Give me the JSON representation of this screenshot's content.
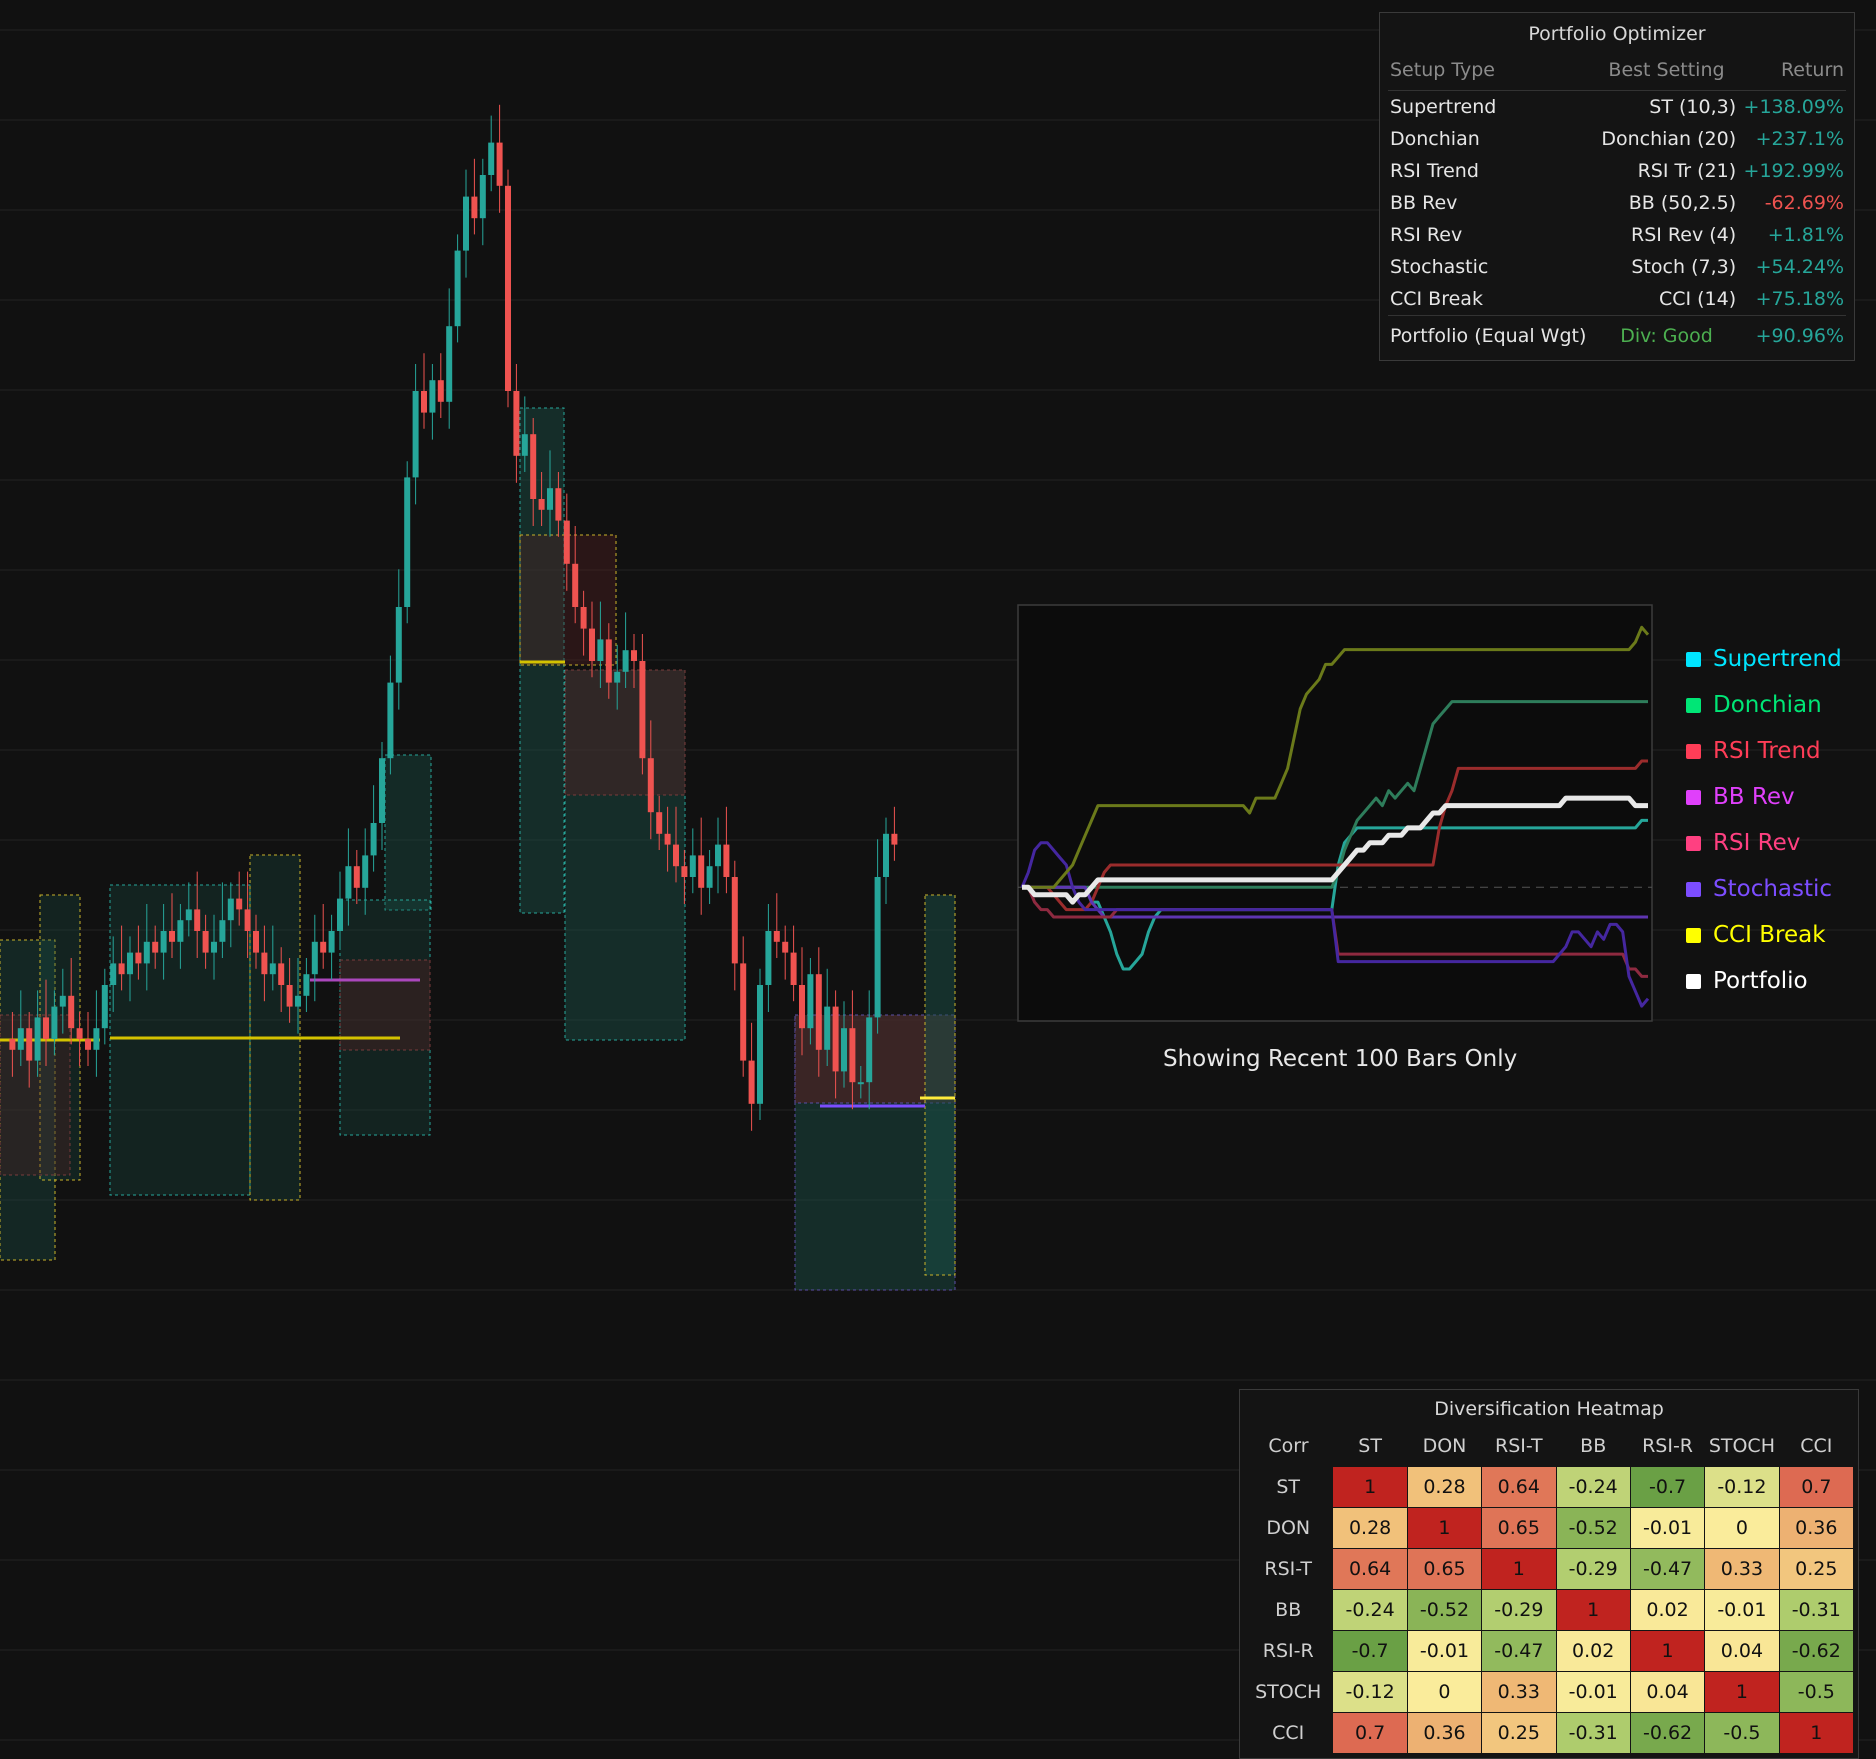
{
  "colors": {
    "background": "#111111",
    "bull": "#26a69a",
    "bear": "#ef5350",
    "positive": "#26a69a",
    "negative": "#ef5350",
    "good": "#4caf50"
  },
  "optimizer": {
    "title": "Portfolio Optimizer",
    "headers": [
      "Setup Type",
      "Best Setting",
      "Return"
    ],
    "rows": [
      {
        "setup": "Supertrend",
        "setting": "ST (10,3)",
        "ret": "+138.09%",
        "sign": "pos"
      },
      {
        "setup": "Donchian",
        "setting": "Donchian (20)",
        "ret": "+237.1%",
        "sign": "pos"
      },
      {
        "setup": "RSI Trend",
        "setting": "RSI Tr (21)",
        "ret": "+192.99%",
        "sign": "pos"
      },
      {
        "setup": "BB Rev",
        "setting": "BB (50,2.5)",
        "ret": "-62.69%",
        "sign": "neg"
      },
      {
        "setup": "RSI Rev",
        "setting": "RSI Rev (4)",
        "ret": "+1.81%",
        "sign": "pos"
      },
      {
        "setup": "Stochastic",
        "setting": "Stoch (7,3)",
        "ret": "+54.24%",
        "sign": "pos"
      },
      {
        "setup": "CCI Break",
        "setting": "CCI (14)",
        "ret": "+75.18%",
        "sign": "pos"
      }
    ],
    "summary": {
      "label": "Portfolio (Equal Wgt)",
      "div": "Div: Good",
      "ret": "+90.96%"
    }
  },
  "legend": [
    {
      "label": "Supertrend",
      "color": "#00e5ff"
    },
    {
      "label": "Donchian",
      "color": "#00e676"
    },
    {
      "label": "RSI Trend",
      "color": "#ff3d57"
    },
    {
      "label": "BB Rev",
      "color": "#e040fb"
    },
    {
      "label": "RSI Rev",
      "color": "#ff4081"
    },
    {
      "label": "Stochastic",
      "color": "#7c4dff"
    },
    {
      "label": "CCI Break",
      "color": "#ffff00"
    },
    {
      "label": "Portfolio",
      "color": "#ffffff"
    }
  ],
  "equity_caption": "Showing Recent 100 Bars Only",
  "heatmap": {
    "title": "Diversification Heatmap",
    "corner": "Corr",
    "labels": [
      "ST",
      "DON",
      "RSI-T",
      "BB",
      "RSI-R",
      "STOCH",
      "CCI"
    ],
    "matrix": [
      [
        1,
        0.28,
        0.64,
        -0.24,
        -0.7,
        -0.12,
        0.7
      ],
      [
        0.28,
        1,
        0.65,
        -0.52,
        -0.01,
        0,
        0.36
      ],
      [
        0.64,
        0.65,
        1,
        -0.29,
        -0.47,
        0.33,
        0.25
      ],
      [
        -0.24,
        -0.52,
        -0.29,
        1,
        0.02,
        -0.01,
        -0.31
      ],
      [
        -0.7,
        -0.01,
        -0.47,
        0.02,
        1,
        0.04,
        -0.62
      ],
      [
        -0.12,
        0,
        0.33,
        -0.01,
        0.04,
        1,
        -0.5
      ],
      [
        0.7,
        0.36,
        0.25,
        -0.31,
        -0.62,
        -0.5,
        1
      ]
    ]
  },
  "chart_data": [
    {
      "type": "candlestick",
      "note": "price series (approximate, unlabeled axes)",
      "close": [
        100,
        99,
        101,
        98,
        102,
        100,
        103,
        104,
        101,
        100,
        99,
        101,
        105,
        107,
        106,
        108,
        107,
        109,
        108,
        110,
        109,
        111,
        112,
        110,
        108,
        109,
        111,
        113,
        112,
        110,
        108,
        106,
        107,
        105,
        103,
        104,
        106,
        109,
        108,
        110,
        113,
        116,
        114,
        117,
        120,
        126,
        133,
        140,
        152,
        160,
        158,
        161,
        159,
        166,
        173,
        178,
        176,
        180,
        183,
        179,
        160,
        154,
        156,
        150,
        149,
        151,
        148,
        144,
        140,
        138,
        135,
        137,
        133,
        134,
        136,
        135,
        126,
        121,
        119,
        118,
        116,
        115,
        117,
        114,
        116,
        118,
        115,
        107,
        98,
        94,
        105,
        110,
        109,
        108,
        105,
        101,
        106,
        99,
        103,
        97,
        101,
        96,
        96,
        102,
        115,
        119,
        118
      ],
      "ylim": [
        80,
        195
      ]
    },
    {
      "type": "line",
      "title": "Showing Recent 100 Bars Only",
      "series": [
        {
          "name": "Supertrend",
          "color": "#26a69a",
          "values": [
            0,
            0,
            0,
            0,
            0,
            0,
            0,
            0,
            0,
            0,
            0,
            -2,
            -2,
            -4,
            -6,
            -9,
            -11,
            -11,
            -10,
            -9,
            -6,
            -4,
            -3,
            -3,
            -3,
            -3,
            -3,
            -3,
            -3,
            -3,
            -3,
            -3,
            -3,
            -3,
            -3,
            -3,
            -3,
            -3,
            -3,
            -3,
            -3,
            -3,
            -3,
            -3,
            -3,
            -3,
            -3,
            -3,
            -3,
            -3,
            3,
            6,
            7,
            8,
            8,
            8,
            8,
            8,
            8,
            8,
            8,
            8,
            8,
            8,
            8,
            8,
            8,
            8,
            8,
            8,
            8,
            8,
            8,
            8,
            8,
            8,
            8,
            8,
            8,
            8,
            8,
            8,
            8,
            8,
            8,
            8,
            8,
            8,
            8,
            8,
            8,
            8,
            8,
            8,
            8,
            8,
            8,
            8,
            9,
            9
          ]
        },
        {
          "name": "Donchian",
          "color": "#2e7d5b",
          "values": [
            0,
            0,
            0,
            0,
            0,
            0,
            0,
            0,
            0,
            0,
            0,
            0,
            0,
            0,
            0,
            0,
            0,
            0,
            0,
            0,
            0,
            0,
            0,
            0,
            0,
            0,
            0,
            0,
            0,
            0,
            0,
            0,
            0,
            0,
            0,
            0,
            0,
            0,
            0,
            0,
            0,
            0,
            0,
            0,
            0,
            0,
            0,
            0,
            0,
            0,
            2,
            5,
            7,
            9,
            10,
            11,
            12,
            11,
            13,
            12,
            13,
            14,
            13,
            16,
            19,
            22,
            23,
            24,
            25,
            25,
            25,
            25,
            25,
            25,
            25,
            25,
            25,
            25,
            25,
            25,
            25,
            25,
            25,
            25,
            25,
            25,
            25,
            25,
            25,
            25,
            25,
            25,
            25,
            25,
            25,
            25,
            25,
            25,
            25,
            25
          ]
        },
        {
          "name": "RSI Trend",
          "color": "#9b2c2c",
          "values": [
            0,
            0,
            0,
            0,
            0,
            -1,
            -2,
            -3,
            -3,
            -3,
            -3,
            -2,
            0,
            2,
            3,
            3,
            3,
            3,
            3,
            3,
            3,
            3,
            3,
            3,
            3,
            3,
            3,
            3,
            3,
            3,
            3,
            3,
            3,
            3,
            3,
            3,
            3,
            3,
            3,
            3,
            3,
            3,
            3,
            3,
            3,
            3,
            3,
            3,
            3,
            3,
            3,
            3,
            3,
            3,
            3,
            3,
            3,
            3,
            3,
            3,
            3,
            3,
            3,
            3,
            3,
            3,
            8,
            11,
            13,
            16,
            16,
            16,
            16,
            16,
            16,
            16,
            16,
            16,
            16,
            16,
            16,
            16,
            16,
            16,
            16,
            16,
            16,
            16,
            16,
            16,
            16,
            16,
            16,
            16,
            16,
            16,
            16,
            16,
            17,
            17
          ]
        },
        {
          "name": "BB Rev",
          "color": "#5e35b1",
          "values": [
            0,
            0,
            0,
            0,
            0,
            0,
            0,
            0,
            0,
            0,
            0,
            -2,
            -3,
            -4,
            -4,
            -4,
            -4,
            -4,
            -4,
            -4,
            -4,
            -4,
            -4,
            -4,
            -4,
            -4,
            -4,
            -4,
            -4,
            -4,
            -4,
            -4,
            -4,
            -4,
            -4,
            -4,
            -4,
            -4,
            -4,
            -4,
            -4,
            -4,
            -4,
            -4,
            -4,
            -4,
            -4,
            -4,
            -4,
            -4,
            -4,
            -4,
            -4,
            -4,
            -4,
            -4,
            -4,
            -4,
            -4,
            -4,
            -4,
            -4,
            -4,
            -4,
            -4,
            -4,
            -4,
            -4,
            -4,
            -4,
            -4,
            -4,
            -4,
            -4,
            -4,
            -4,
            -4,
            -4,
            -4,
            -4,
            -4,
            -4,
            -4,
            -4,
            -4,
            -4,
            -4,
            -4,
            -4,
            -4,
            -4,
            -4,
            -4,
            -4,
            -4,
            -4,
            -4,
            -4,
            -4,
            -4
          ]
        },
        {
          "name": "RSI Rev",
          "color": "#8e2a40",
          "values": [
            0,
            0,
            -2,
            -3,
            -3,
            -4,
            -4,
            -4,
            -4,
            -4,
            -4,
            -4,
            -4,
            -4,
            -4,
            -3,
            -3,
            -3,
            -3,
            -3,
            -3,
            -3,
            -3,
            -3,
            -3,
            -3,
            -3,
            -3,
            -3,
            -3,
            -3,
            -3,
            -3,
            -3,
            -3,
            -3,
            -3,
            -3,
            -3,
            -3,
            -3,
            -3,
            -3,
            -3,
            -3,
            -3,
            -3,
            -3,
            -3,
            -3,
            -9,
            -9,
            -9,
            -9,
            -9,
            -9,
            -9,
            -9,
            -9,
            -9,
            -9,
            -9,
            -9,
            -9,
            -9,
            -9,
            -9,
            -9,
            -9,
            -9,
            -9,
            -9,
            -9,
            -9,
            -9,
            -9,
            -9,
            -9,
            -9,
            -9,
            -9,
            -9,
            -9,
            -9,
            -9,
            -9,
            -9,
            -9,
            -9,
            -9,
            -9,
            -9,
            -9,
            -9,
            -9,
            -9,
            -11,
            -11,
            -12,
            -12
          ]
        },
        {
          "name": "Stochastic",
          "color": "#4527a0",
          "values": [
            0,
            2,
            5,
            6,
            6,
            5,
            4,
            3,
            0,
            -2,
            -3,
            -3,
            -3,
            -3,
            -3,
            -3,
            -3,
            -3,
            -3,
            -3,
            -3,
            -3,
            -3,
            -3,
            -3,
            -3,
            -3,
            -3,
            -3,
            -3,
            -3,
            -3,
            -3,
            -3,
            -3,
            -3,
            -3,
            -3,
            -3,
            -3,
            -3,
            -3,
            -3,
            -3,
            -3,
            -3,
            -3,
            -3,
            -3,
            -3,
            -10,
            -10,
            -10,
            -10,
            -10,
            -10,
            -10,
            -10,
            -10,
            -10,
            -10,
            -10,
            -10,
            -10,
            -10,
            -10,
            -10,
            -10,
            -10,
            -10,
            -10,
            -10,
            -10,
            -10,
            -10,
            -10,
            -10,
            -10,
            -10,
            -10,
            -10,
            -10,
            -10,
            -10,
            -10,
            -9,
            -8,
            -6,
            -6,
            -7,
            -8,
            -6,
            -7,
            -5,
            -5,
            -6,
            -12,
            -14,
            -16,
            -15
          ]
        },
        {
          "name": "CCI Break",
          "color": "#6b7a1a",
          "values": [
            0,
            0,
            0,
            0,
            0,
            0,
            1,
            2,
            3,
            5,
            7,
            9,
            11,
            11,
            11,
            11,
            11,
            11,
            11,
            11,
            11,
            11,
            11,
            11,
            11,
            11,
            11,
            11,
            11,
            11,
            11,
            11,
            11,
            11,
            11,
            11,
            10,
            12,
            12,
            12,
            12,
            14,
            16,
            20,
            24,
            26,
            27,
            28,
            30,
            30,
            31,
            32,
            32,
            32,
            32,
            32,
            32,
            32,
            32,
            32,
            32,
            32,
            32,
            32,
            32,
            32,
            32,
            32,
            32,
            32,
            32,
            32,
            32,
            32,
            32,
            32,
            32,
            32,
            32,
            32,
            32,
            32,
            32,
            32,
            32,
            32,
            32,
            32,
            32,
            32,
            32,
            32,
            32,
            32,
            32,
            32,
            32,
            33,
            35,
            34
          ]
        },
        {
          "name": "Portfolio",
          "color": "#e8e8e8",
          "values": [
            0,
            0,
            -1,
            -1,
            -1,
            -1,
            -1,
            -1,
            -2,
            -1,
            -1,
            0,
            1,
            1,
            1,
            1,
            1,
            1,
            1,
            1,
            1,
            1,
            1,
            1,
            1,
            1,
            1,
            1,
            1,
            1,
            1,
            1,
            1,
            1,
            1,
            1,
            1,
            1,
            1,
            1,
            1,
            1,
            1,
            1,
            1,
            1,
            1,
            1,
            1,
            1,
            2,
            3,
            4,
            5,
            5,
            6,
            6,
            6,
            7,
            7,
            7,
            8,
            8,
            8,
            9,
            10,
            10,
            11,
            11,
            11,
            11,
            11,
            11,
            11,
            11,
            11,
            11,
            11,
            11,
            11,
            11,
            11,
            11,
            11,
            11,
            11,
            12,
            12,
            12,
            12,
            12,
            12,
            12,
            12,
            12,
            12,
            12,
            11,
            11,
            11
          ]
        }
      ],
      "baseline": 0,
      "ylim": [
        -18,
        38
      ]
    }
  ]
}
